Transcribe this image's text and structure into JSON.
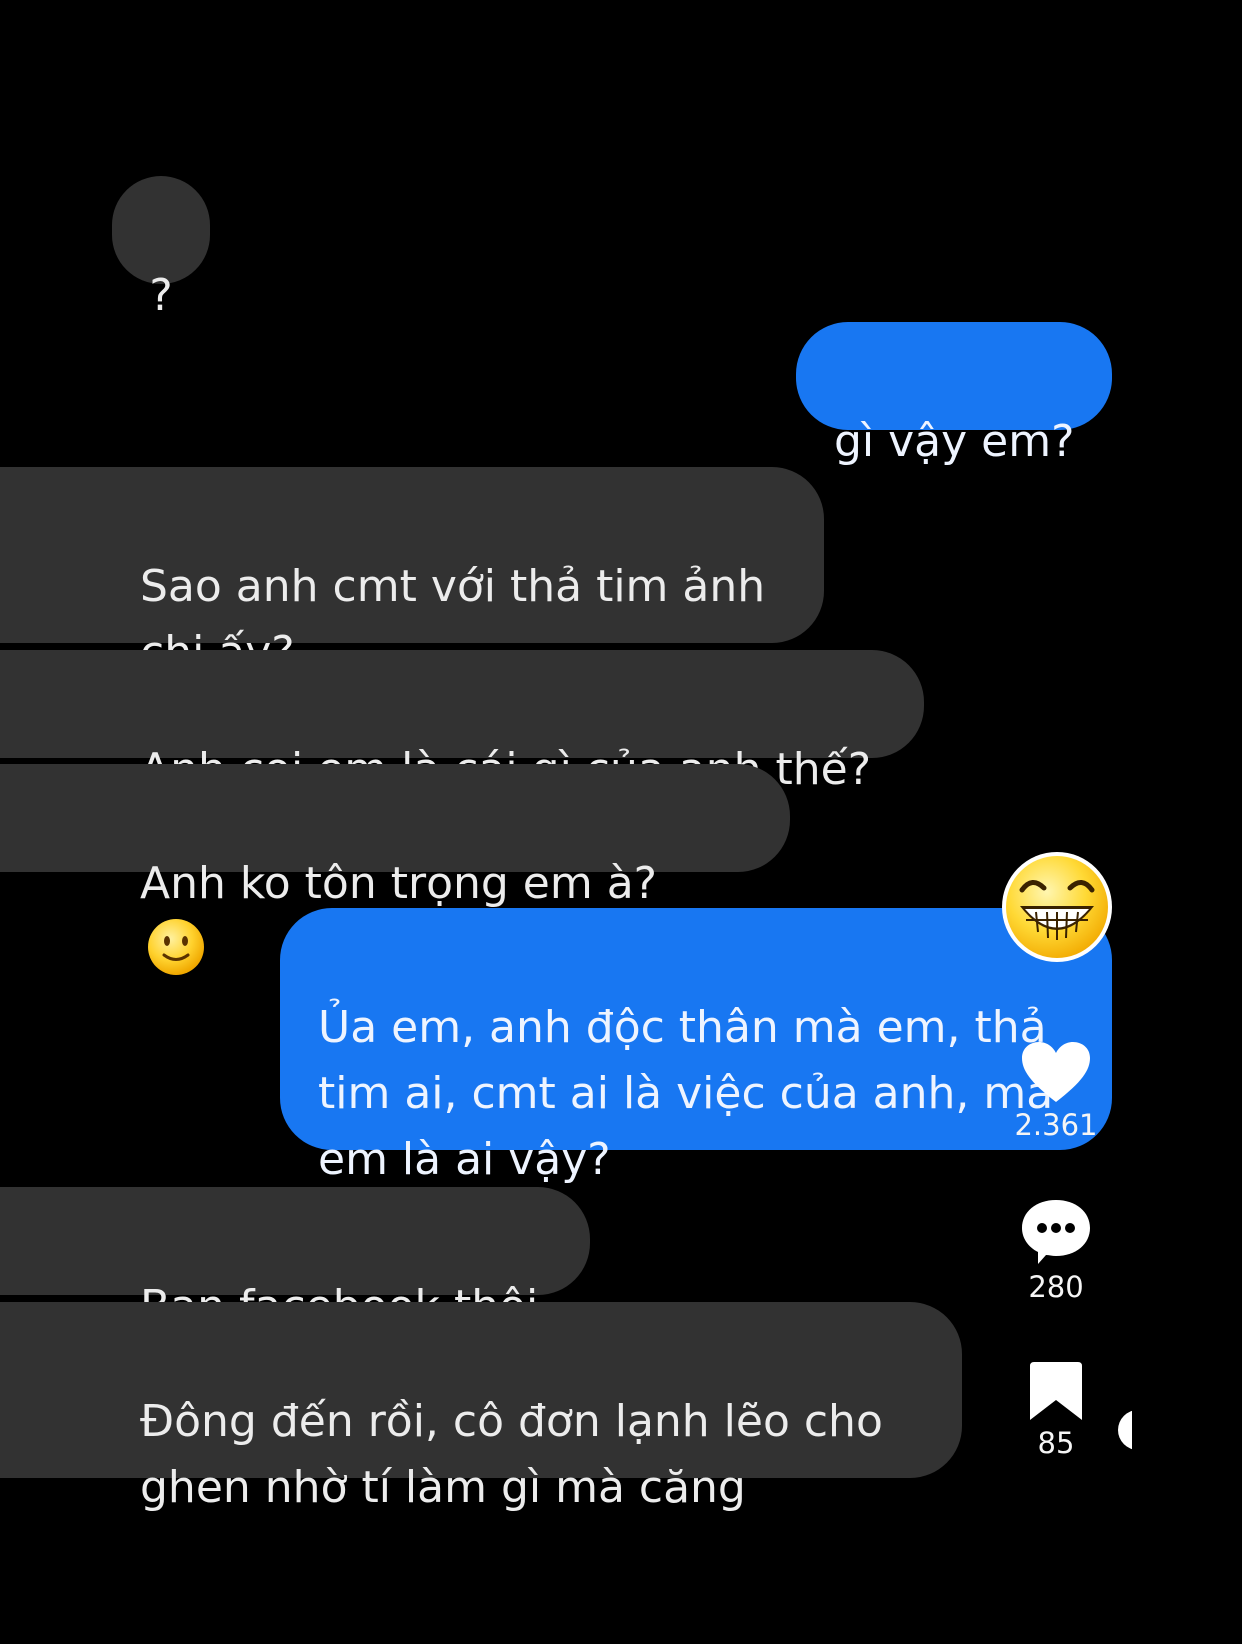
{
  "messages": [
    {
      "id": "m1",
      "side": "received",
      "text": "?"
    },
    {
      "id": "m2",
      "side": "sent",
      "text": "gì vậy em?"
    },
    {
      "id": "m3",
      "side": "received",
      "text": "Sao anh cmt với thả tim ảnh\nchị ấy?"
    },
    {
      "id": "m4",
      "side": "received",
      "text": "Anh coi em là cái gì của anh thế?"
    },
    {
      "id": "m5",
      "side": "received",
      "text": "Anh ko tôn trọng em à?",
      "emoji": "slightly-smiling-face"
    },
    {
      "id": "m6",
      "side": "sent",
      "text": "Ủa em, anh độc thân mà em, thả\ntim ai, cmt ai là việc của anh, mà\nem là ai vậy?"
    },
    {
      "id": "m7",
      "side": "received",
      "text": "Bạn facebook thôi"
    },
    {
      "id": "m8",
      "side": "received",
      "text": "Đông đến rồi, cô đơn lạnh lẽo cho\nghen nhờ tí làm gì mà căng"
    }
  ],
  "overlay": {
    "reaction_sticker": "grinning-face-sticker",
    "likes": "2.361",
    "comments": "280",
    "bookmarks": "85"
  },
  "colors": {
    "background": "#000000",
    "received_bubble": "#323232",
    "sent_bubble": "#1877f2"
  }
}
